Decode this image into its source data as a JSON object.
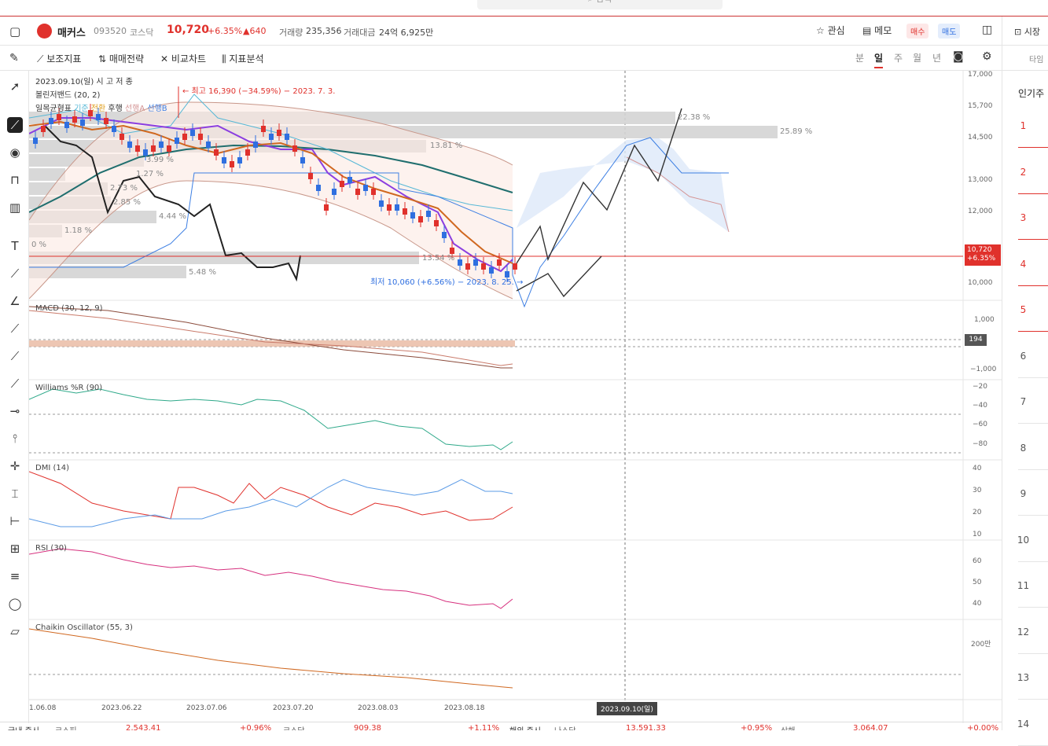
{
  "search": {
    "placeholder": "검색"
  },
  "header": {
    "stock_name": "매커스",
    "code": "093520",
    "market": "코스닥",
    "price": "10,720",
    "change_pct": "+6.35%",
    "change_abs": "▲640",
    "volume_label": "거래량",
    "volume": "235,356",
    "amount_label": "거래대금",
    "amount": "24억 6,925만",
    "favorite": "관심",
    "memo": "메모",
    "buy": "매수",
    "sell": "매도",
    "market_status": "시장"
  },
  "toolbar": {
    "indicators": "보조지표",
    "strategy": "매매전략",
    "compare": "비교차트",
    "analysis": "지표분석",
    "periods": [
      "분",
      "일",
      "주",
      "월",
      "년"
    ],
    "active_period": "일"
  },
  "chart_info": {
    "date_line": "2023.09.10(일)  시  고  저  종",
    "bollinger": "볼린저밴드 (20, 2)",
    "ichimoku": [
      "일목균형표",
      "기준",
      "전환",
      "후행",
      "선행A",
      "선행B"
    ],
    "high_label": "← 최고 16,390 (−34.59%) − 2023. 7. 3.",
    "low_label": "최저 10,060 (+6.56%) − 2023. 8. 25. →",
    "cursor_date": "2023.09.10(일)"
  },
  "volume_profile": [
    "22.38 %",
    "25.89 %",
    "13.81 %",
    "3.99 %",
    "1.27 %",
    "2.73 %",
    "2.85 %",
    "4.44 %",
    "1.18 %",
    "0 %",
    "13.54 %",
    "5.48 %"
  ],
  "price_axis": [
    "17,000",
    "15,700",
    "14,500",
    "13,000",
    "12,000",
    "10,000"
  ],
  "current_price_tag": {
    "price": "10,720",
    "pct": "+6.35%"
  },
  "macd": {
    "label": "MACD (30, 12, 9)",
    "axis": [
      "1,000",
      "−1,000"
    ],
    "tag": "194"
  },
  "williams": {
    "label": "Williams %R (90)",
    "axis": [
      "−20",
      "−40",
      "−60",
      "−80"
    ]
  },
  "dmi": {
    "label": "DMI (14)",
    "axis": [
      "40",
      "30",
      "20",
      "10"
    ]
  },
  "rsi": {
    "label": "RSI (30)",
    "axis": [
      "60",
      "50",
      "40"
    ]
  },
  "chaikin": {
    "label": "Chaikin Oscillator (55, 3)",
    "axis": [
      "200만"
    ]
  },
  "x_axis": [
    "1.06.08",
    "2023.06.22",
    "2023.07.06",
    "2023.07.20",
    "2023.08.03",
    "2023.08.18"
  ],
  "right_panel": {
    "timing": "타임",
    "popular": "인기주",
    "ranks": [
      "1",
      "2",
      "3",
      "4",
      "5",
      "6",
      "7",
      "8",
      "9",
      "10",
      "11",
      "12",
      "13",
      "14"
    ]
  },
  "bottom": {
    "domestic": "국내 증시",
    "kospi": "코스피",
    "kospi_val": "2,543.41",
    "kospi_pct": "+0.96%",
    "kosdaq": "코스닥",
    "kosdaq_val": "909.38",
    "kosdaq_pct": "+1.11%",
    "overseas": "해외 증시",
    "nasdaq": "나스닥",
    "nasdaq_val": "13,591.33",
    "nasdaq_pct": "+0.95%",
    "shanghai": "상해",
    "shanghai_val": "3,064.07",
    "shanghai_pct": "+0.00%"
  },
  "colors": {
    "up": "#e0312c",
    "down": "#2f6fe0",
    "accent": "#e0312c"
  }
}
